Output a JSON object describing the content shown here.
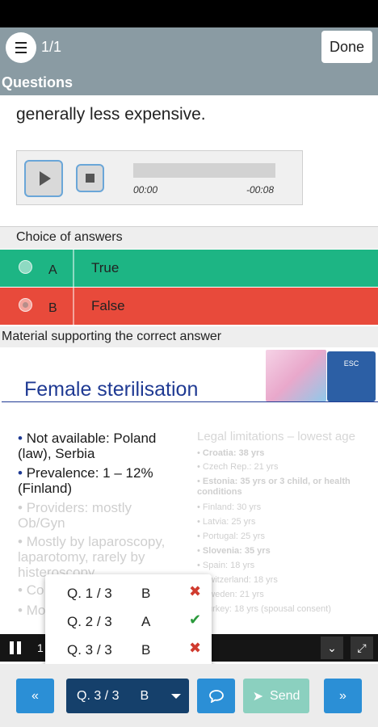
{
  "header": {
    "counter": "1/1",
    "done_label": "Done",
    "section_title": "Questions"
  },
  "question": {
    "text": "generally less expensive."
  },
  "audio": {
    "elapsed": "00:00",
    "remaining": "-00:08"
  },
  "answers": {
    "header": "Choice of answers",
    "items": [
      {
        "letter": "A",
        "text": "True",
        "color": "#1db584"
      },
      {
        "letter": "B",
        "text": "False",
        "color": "#e84a3b"
      }
    ]
  },
  "support": {
    "header": "Material supporting the correct answer",
    "slide": {
      "title": "Female sterilisation",
      "logo_text": "ESC",
      "bullets": [
        "Not available: Poland (law), Serbia",
        "Prevalence: 1 – 12% (Finland)",
        "Providers: mostly Ob/Gyn",
        "Mostly by laparoscopy, laparotomy, rarely by histeroscopy",
        "Co",
        "Mo"
      ],
      "right_header": "Legal limitations – lowest age",
      "right_items": [
        "Croatia: 38 yrs",
        "Czech Rep.: 21 yrs",
        "Estonia: 35 yrs or 3 child, or health conditions",
        "Finland: 30 yrs",
        "Latvia: 25 yrs",
        "Portugal: 25 yrs",
        "Slovenia: 35 yrs",
        "Spain: 18 yrs",
        "Switzerland: 18 yrs",
        "Sweden: 21 yrs",
        "Turkey: 18 yrs (spousal consent)"
      ]
    }
  },
  "video": {
    "time": "1"
  },
  "popup": {
    "rows": [
      {
        "question": "Q. 1 / 3",
        "answer": "B",
        "result": "✖"
      },
      {
        "question": "Q. 2 / 3",
        "answer": "A",
        "result": "✔"
      },
      {
        "question": "Q. 3 / 3",
        "answer": "B",
        "result": "✖"
      }
    ]
  },
  "bottom": {
    "prev_label": "«",
    "question_select": "Q. 3 / 3",
    "question_select_answer": "B",
    "send_label": "Send",
    "next_label": "»"
  }
}
